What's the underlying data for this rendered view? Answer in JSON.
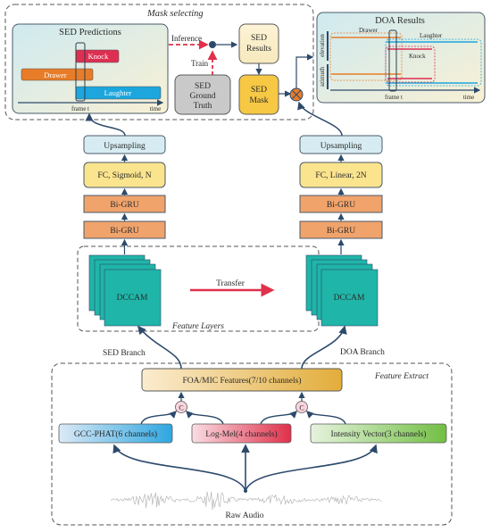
{
  "groups": {
    "mask_selecting": "Mask selecting",
    "feature_layers": "Feature Layers",
    "feature_extract": "Feature Extract"
  },
  "sed_predictions": {
    "title": "SED Predictions",
    "events": [
      "Knock",
      "Drawer",
      "Laughter"
    ],
    "x_label_frame": "frame t",
    "x_label_time": "time"
  },
  "mask_flow": {
    "inference": "Inference",
    "train": "Train",
    "ground_truth": [
      "SED",
      "Ground",
      "Truth"
    ],
    "sed_results": [
      "SED",
      "Results"
    ],
    "sed_mask": [
      "SED",
      "Mask"
    ]
  },
  "doa_results": {
    "title": "DOA Results",
    "events": [
      "Drawer",
      "Laughter",
      "Knock"
    ],
    "y_labels": [
      "elevation",
      "azimuth"
    ],
    "x_label_frame": "frame t",
    "x_label_time": "time"
  },
  "sed_branch": {
    "label": "SED Branch",
    "upsampling": "Upsampling",
    "fc": "FC, Sigmoid, N",
    "gru1": "Bi-GRU",
    "gru2": "Bi-GRU",
    "dccam": "DCCAM"
  },
  "doa_branch": {
    "label": "DOA Branch",
    "upsampling": "Upsampling",
    "fc": "FC, Linear, 2N",
    "gru1": "Bi-GRU",
    "gru2": "Bi-GRU",
    "dccam": "DCCAM"
  },
  "transfer": "Transfer",
  "features": {
    "combined": "FOA/MIC Features(7/10 channels)",
    "concat_symbol": "C",
    "gcc": "GCC-PHAT(6 channels)",
    "logmel": "Log-Mel(4 channels)",
    "intensity": "Intensity Vector(3 channels)",
    "raw_audio": "Raw Audio"
  },
  "colors": {
    "arrow": "#2d4a6b",
    "red_dashed": "#e0304a",
    "gru": "#f0a36b",
    "fc": "#fbe48e",
    "upsampling": "#d6ecf2",
    "dccam": "#1fb5a8",
    "knock": "#dd2f52",
    "drawer": "#e87c28",
    "laughter": "#1ca6dd",
    "mask": "#f6c843",
    "ground_truth": "#c9c9c9"
  }
}
